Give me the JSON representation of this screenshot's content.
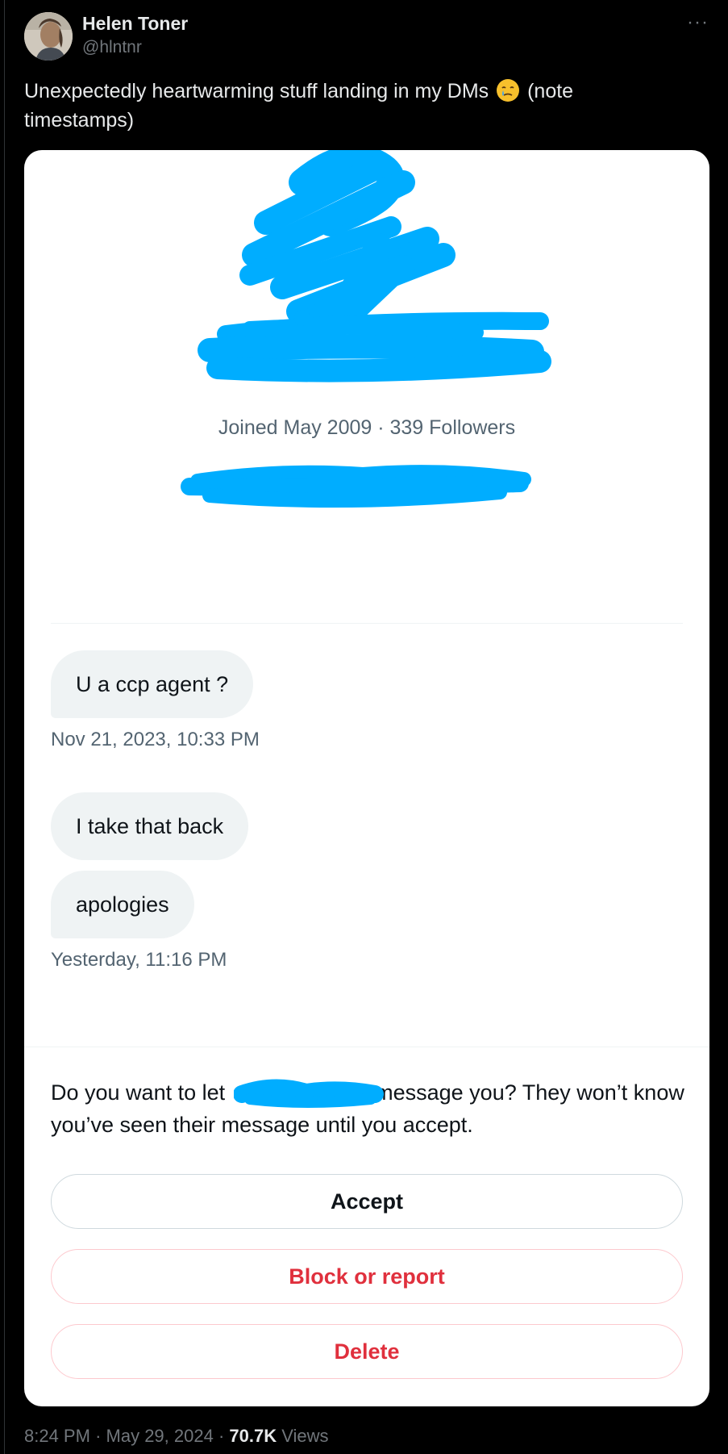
{
  "author": {
    "name": "Helen Toner",
    "handle": "@hlntnr"
  },
  "tweet": {
    "text_before": "Unexpectedly heartwarming stuff landing in my DMs",
    "emoji": "face-holding-back-tears-icon",
    "text_after": "(note timestamps)"
  },
  "card": {
    "profile_meta": "Joined May 2009 · 339 Followers",
    "messages": [
      {
        "text": "U a ccp agent ?"
      },
      {
        "text": "I take that back"
      },
      {
        "text": "apologies"
      }
    ],
    "timestamps": [
      "Nov 21, 2023, 10:33 PM",
      "Yesterday, 11:16 PM"
    ],
    "prompt_before": "Do you want to let",
    "prompt_after": "message you? They won’t know you’ve seen their message until you accept.",
    "buttons": {
      "accept": "Accept",
      "block": "Block or report",
      "delete": "Delete"
    }
  },
  "footer": {
    "time": "8:24 PM",
    "date": "May 29, 2024",
    "views_count": "70.7K",
    "views_label": "Views"
  },
  "colors": {
    "background": "#000000",
    "redaction": "#00adff",
    "danger": "#e0303d"
  }
}
